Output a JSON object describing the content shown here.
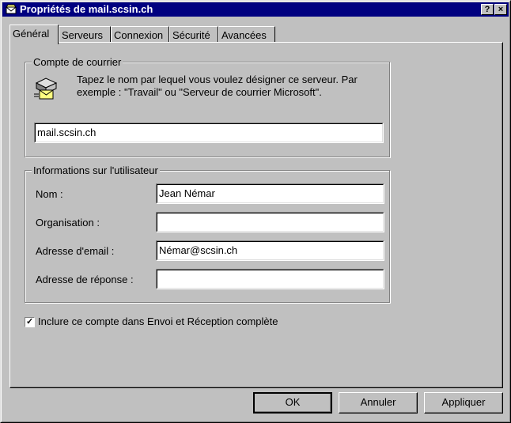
{
  "window": {
    "title": "Propriétés de mail.scsin.ch",
    "help_button": "?",
    "close_button": "×"
  },
  "tabs": [
    {
      "label": "Général",
      "active": true
    },
    {
      "label": "Serveurs"
    },
    {
      "label": "Connexion"
    },
    {
      "label": "Sécurité"
    },
    {
      "label": "Avancées"
    }
  ],
  "account_group": {
    "legend": "Compte de courrier",
    "description": "Tapez le nom par lequel vous voulez désigner ce serveur. Par exemple : \"Travail\" ou \"Serveur de courrier Microsoft\".",
    "account_name_value": "mail.scsin.ch",
    "icon": "mail-server-icon"
  },
  "user_group": {
    "legend": "Informations sur l'utilisateur",
    "name_label": "Nom :",
    "name_value": "Jean Némar",
    "organisation_label": "Organisation :",
    "organisation_value": "",
    "email_label": "Adresse d'email :",
    "email_value": "Némar@scsin.ch",
    "reply_label": "Adresse de réponse :",
    "reply_value": ""
  },
  "include_checkbox": {
    "label": "Inclure ce compte dans Envoi et Réception complète",
    "checked": true
  },
  "buttons": {
    "ok": "OK",
    "cancel": "Annuler",
    "apply": "Appliquer"
  }
}
